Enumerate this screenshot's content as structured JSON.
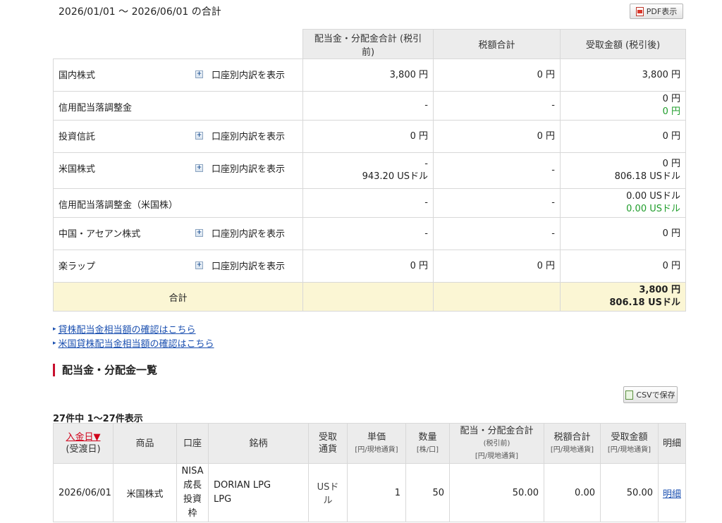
{
  "period_label": "2026/01/01 〜 2026/06/01 の合計",
  "pdf_button": "PDF表示",
  "summary": {
    "headers": [
      "配当金・分配金合計 (税引前)",
      "税額合計",
      "受取金額 (税引後)"
    ],
    "account_link_label": "口座別内訳を表示",
    "rows": [
      {
        "name": "国内株式",
        "has_link": true,
        "pre": [
          "3,800 円"
        ],
        "tax": [
          "0 円"
        ],
        "after": [
          {
            "text": "3,800 円"
          }
        ]
      },
      {
        "name": "信用配当落調整金",
        "has_link": false,
        "pre": [
          "-"
        ],
        "tax": [
          "-"
        ],
        "after": [
          {
            "text": "0 円"
          },
          {
            "text": "0 円",
            "green": true
          }
        ]
      },
      {
        "name": "投資信託",
        "has_link": true,
        "pre": [
          "0 円"
        ],
        "tax": [
          "0 円"
        ],
        "after": [
          {
            "text": "0 円"
          }
        ]
      },
      {
        "name": "米国株式",
        "has_link": true,
        "pre": [
          "-",
          "943.20 USドル"
        ],
        "tax": [
          "-"
        ],
        "after": [
          {
            "text": "0 円"
          },
          {
            "text": "806.18 USドル"
          }
        ]
      },
      {
        "name": "信用配当落調整金（米国株）",
        "has_link": false,
        "pre": [
          "-"
        ],
        "tax": [
          "-"
        ],
        "after": [
          {
            "text": "0.00 USドル"
          },
          {
            "text": "0.00 USドル",
            "green": true
          }
        ]
      },
      {
        "name": "中国・アセアン株式",
        "has_link": true,
        "pre": [
          "-"
        ],
        "tax": [
          "-"
        ],
        "after": [
          {
            "text": "0 円"
          }
        ]
      },
      {
        "name": "楽ラップ",
        "has_link": true,
        "pre": [
          "0 円"
        ],
        "tax": [
          "0 円"
        ],
        "after": [
          {
            "text": "0 円"
          }
        ]
      }
    ],
    "total": {
      "label": "合計",
      "after": [
        "3,800 円",
        "806.18 USドル"
      ]
    }
  },
  "links": [
    "貸株配当金相当額の確認はこちら",
    "米国貸株配当金相当額の確認はこちら"
  ],
  "section_title": "配当金・分配金一覧",
  "csv_button": "CSVで保存",
  "count_label": "27件中 1〜27件表示",
  "list": {
    "headers": {
      "date": "入金日▼",
      "date_sub": "(受渡日)",
      "product": "商品",
      "account": "口座",
      "security": "銘柄",
      "currency": [
        "受取",
        "通貨"
      ],
      "unit_price": "単価",
      "unit_price_sub": "[円/現地通貨]",
      "quantity": "数量",
      "quantity_sub": "[株/口]",
      "gross": "配当・分配金合計",
      "gross_sub1": "(税引前)",
      "gross_sub2": "[円/現地通貨]",
      "tax": "税額合計",
      "tax_sub": "[円/現地通貨]",
      "received": "受取金額",
      "received_sub": "[円/現地通貨]",
      "detail": "明細"
    },
    "rows": [
      {
        "date": "2026/06/01",
        "product": "米国株式",
        "account": [
          "NISA",
          "成長",
          "投資",
          "枠"
        ],
        "security": [
          "DORIAN LPG",
          "LPG"
        ],
        "currency": "USドル",
        "unit_price": "1",
        "quantity": "50",
        "gross": "50.00",
        "tax": "0.00",
        "received": "50.00",
        "detail": "明細"
      }
    ]
  }
}
